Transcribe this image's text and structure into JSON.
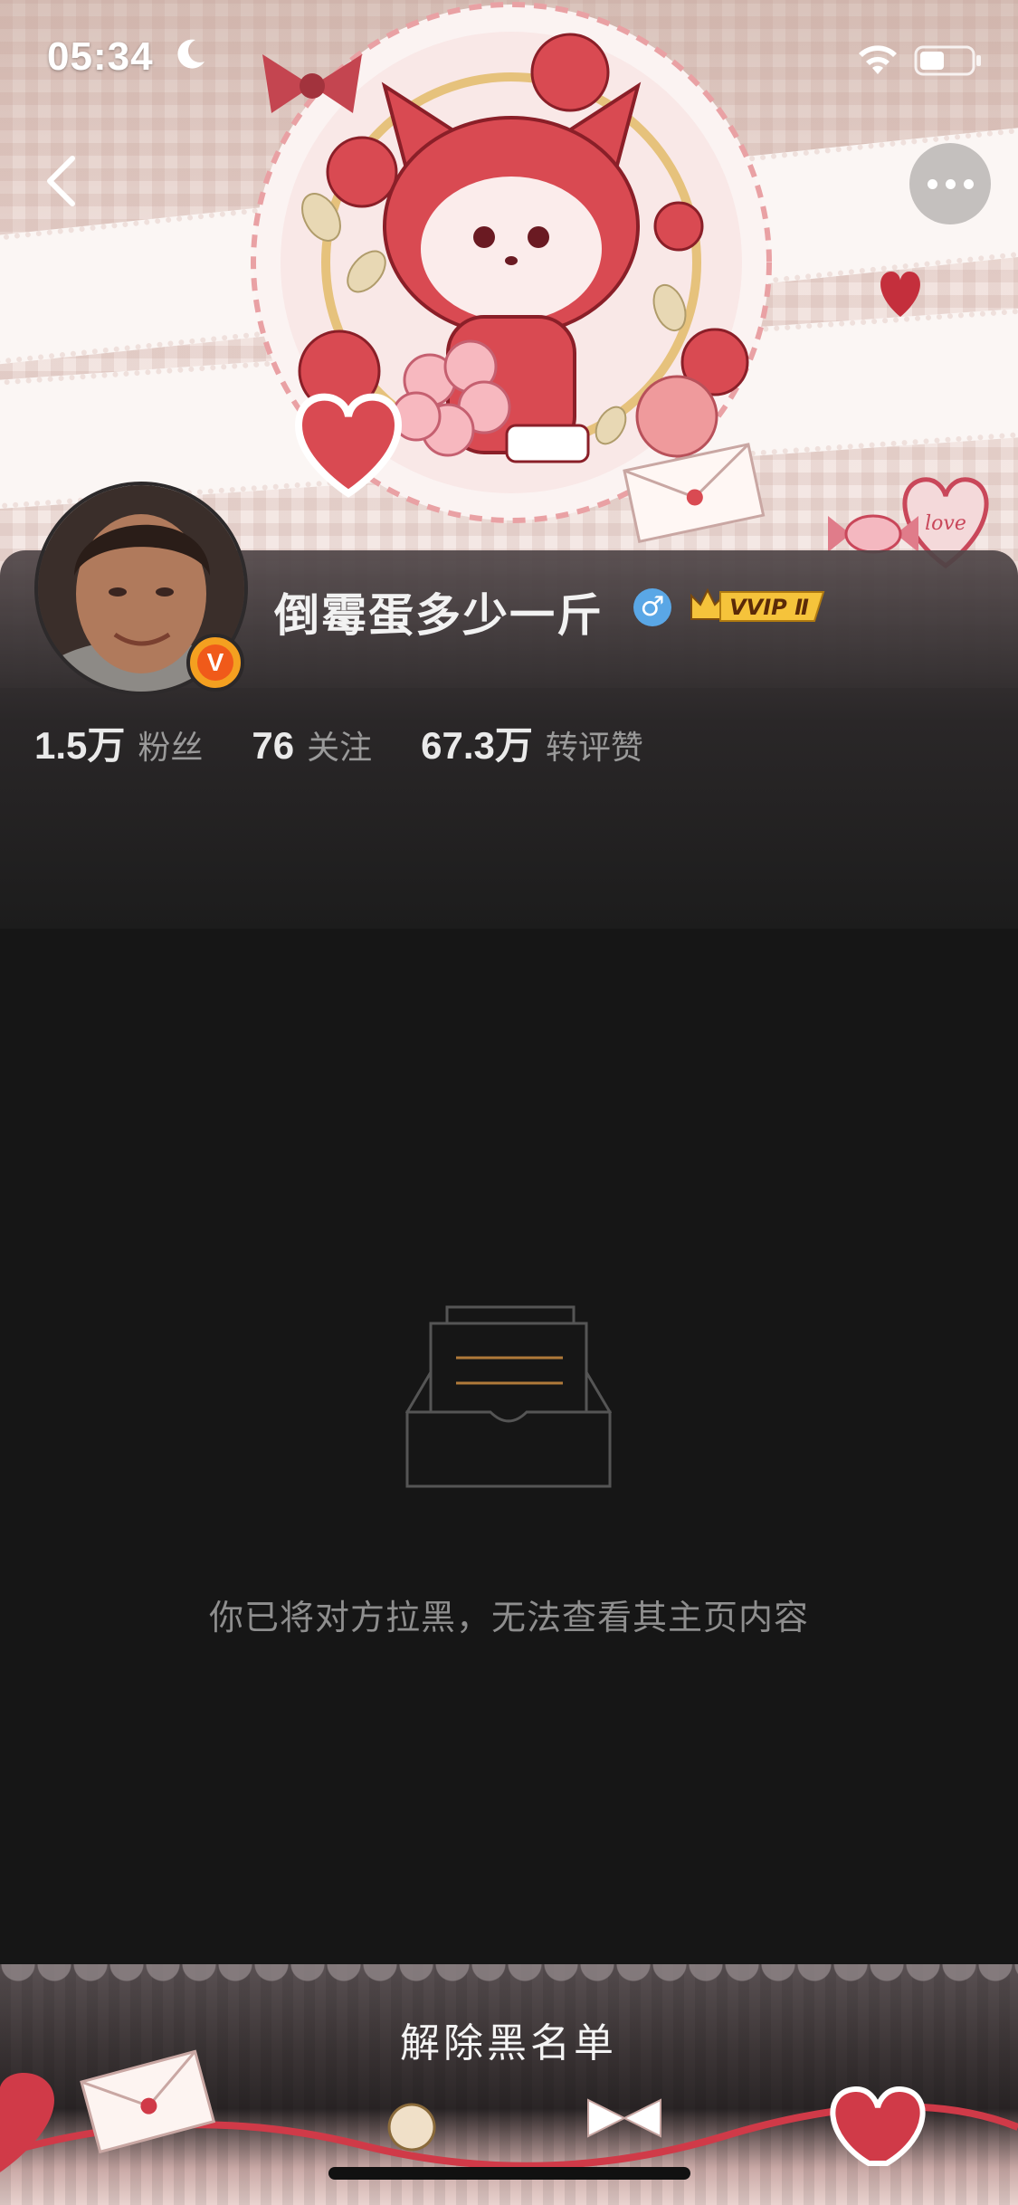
{
  "status_bar": {
    "time": "05:34",
    "moon_icon": "moon-icon",
    "wifi_icon": "wifi-icon",
    "battery_icon": "battery-icon"
  },
  "nav": {
    "back_icon": "chevron-left-icon",
    "more_icon": "more-dots-icon"
  },
  "profile": {
    "username": "倒霉蛋多少一斤",
    "gender_symbol": "♂",
    "verified_badge": "V",
    "vip_label": "VVIP Ⅱ"
  },
  "stats": [
    {
      "value": "1.5万",
      "label": "粉丝"
    },
    {
      "value": "76",
      "label": "关注"
    },
    {
      "value": "67.3万",
      "label": "转评赞"
    }
  ],
  "empty_state": {
    "icon": "empty-inbox-icon",
    "message": "你已将对方拉黑，无法查看其主页内容"
  },
  "footer": {
    "unblock_label": "解除黑名单"
  },
  "colors": {
    "background": "#161616",
    "vip_gold": "#f5c33b",
    "gender_blue": "#5aa7e6",
    "verified_orange": "#f05a1a"
  }
}
